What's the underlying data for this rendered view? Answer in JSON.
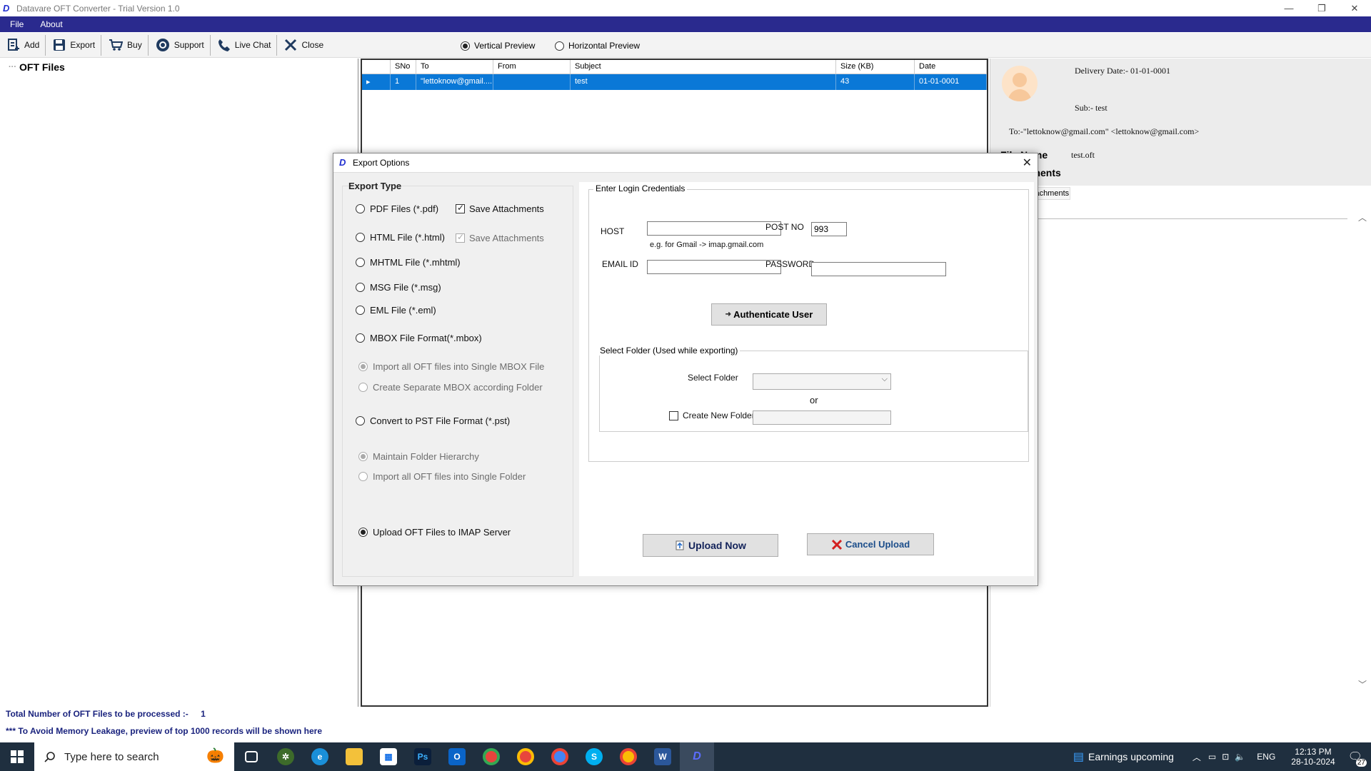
{
  "window": {
    "title": "Datavare OFT Converter - Trial Version 1.0"
  },
  "menu": [
    "File",
    "About"
  ],
  "toolbar": {
    "add": "Add",
    "export": "Export",
    "buy": "Buy",
    "support": "Support",
    "live_chat": "Live Chat",
    "close": "Close",
    "vertical_preview": "Vertical Preview",
    "horizontal_preview": "Horizontal Preview"
  },
  "tree": {
    "root": "OFT Files"
  },
  "grid": {
    "headers": [
      "SNo",
      "To",
      "From",
      "Subject",
      "Size (KB)",
      "Date"
    ],
    "row": {
      "sno": "1",
      "to": "\"lettoknow@gmail....",
      "from": "",
      "subject": "test",
      "size": "43",
      "date": "01-01-0001"
    }
  },
  "preview": {
    "delivery_date": "Delivery Date:- 01-01-0001",
    "subject": "Sub:- test",
    "to": "To:-\"lettoknow@gmail.com\" <lettoknow@gmail.com>",
    "file_name_label": "File Name",
    "file_name_value": "test.oft",
    "attachments_label": "Attachments",
    "tab": "Attachments"
  },
  "status": {
    "total": "Total Number of OFT Files to be processed :-",
    "total_count": "1",
    "memory_note": "*** To Avoid Memory Leakage, preview of top 1000 records will be shown here"
  },
  "dialog": {
    "title": "Export Options",
    "export_type": "Export Type",
    "options": {
      "pdf": "PDF Files (*.pdf)",
      "pdf_save_attachments": "Save Attachments",
      "html": "HTML File  (*.html)",
      "html_save_attachments": "Save Attachments",
      "mhtml": "MHTML File  (*.mhtml)",
      "msg": "MSG File (*.msg)",
      "eml": "EML File (*.eml)",
      "mbox": "MBOX File Format(*.mbox)",
      "mbox_single": "Import all OFT files into Single MBOX File",
      "mbox_separate": "Create Separate MBOX according Folder",
      "pst": "Convert to PST File Format (*.pst)",
      "pst_hierarchy": "Maintain Folder Hierarchy",
      "pst_single": "Import all OFT files into Single Folder",
      "imap": "Upload OFT Files to IMAP Server"
    },
    "login": {
      "legend": "Enter Login Credentials",
      "host_label": "HOST",
      "host_value": "",
      "host_hint": "e.g. for Gmail -> imap.gmail.com",
      "port_label": "POST NO",
      "port_value": "993",
      "email_label": "EMAIL ID",
      "email_value": "",
      "password_label": "PASSWORD",
      "password_value": "",
      "authenticate": "Authenticate User"
    },
    "folder": {
      "legend": "Select Folder (Used while exporting)",
      "select_label": "Select Folder",
      "or": "or",
      "create_label": "Create New Folder"
    },
    "upload_now": "Upload Now",
    "cancel_upload": "Cancel Upload"
  },
  "taskbar": {
    "search_placeholder": "Type here to search",
    "weather": "Earnings upcoming",
    "lang": "ENG",
    "time": "12:13 PM",
    "date": "28-10-2024",
    "notifications": "27"
  },
  "colors": {
    "menubar": "#2a2a8e",
    "selection": "#0a78d7",
    "status_text": "#1a237e",
    "taskbar": "#1f2f3f"
  }
}
